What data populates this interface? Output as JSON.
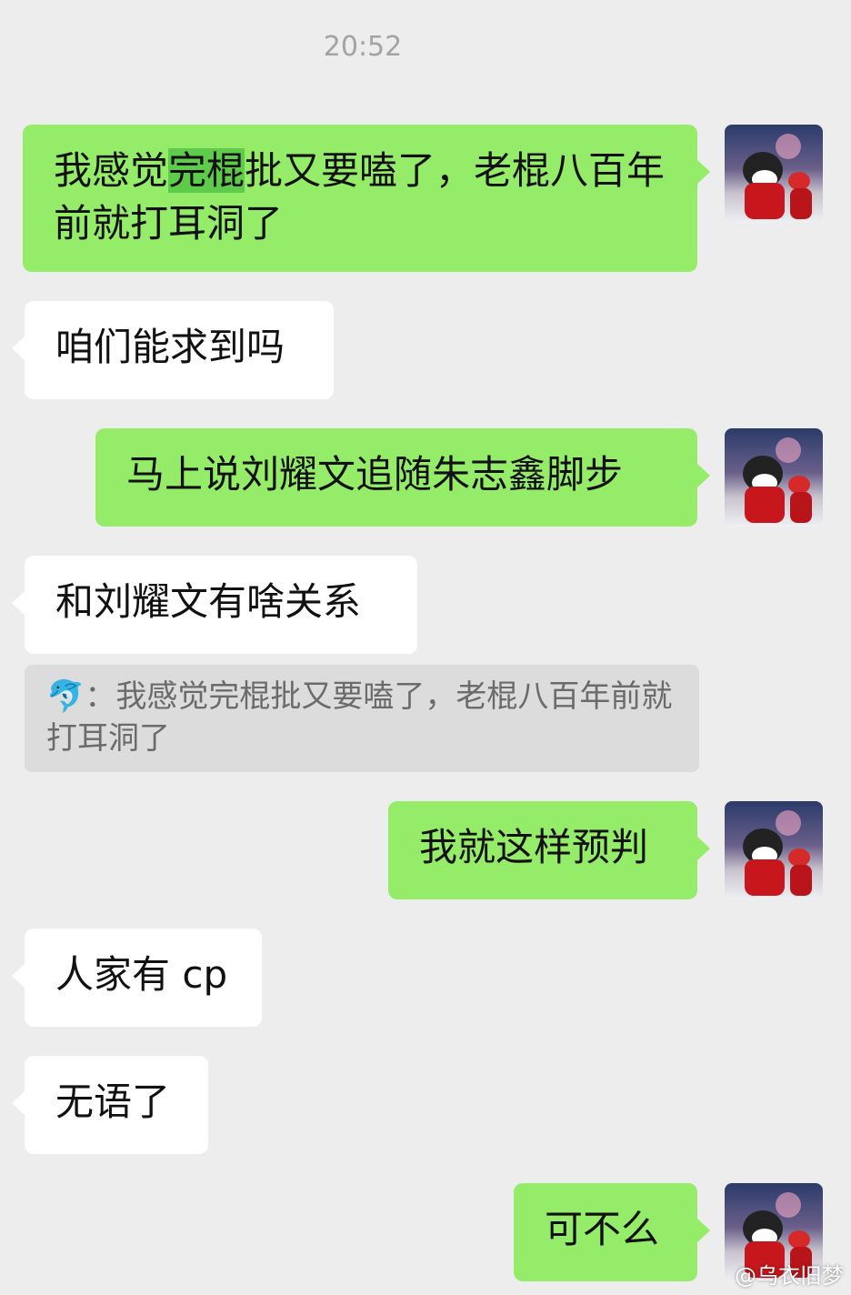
{
  "timestamp": "20:52",
  "messages": [
    {
      "side": "out",
      "before": "我感觉",
      "highlight": "完棍",
      "after": "批又要嗑了，老棍八百年前就打耳洞了"
    },
    {
      "side": "in",
      "text": "咱们能求到吗"
    },
    {
      "side": "out",
      "text": "马上说刘耀文追随朱志鑫脚步"
    },
    {
      "side": "in",
      "text": "和刘耀文有啥关系"
    },
    {
      "side": "out",
      "text": "我就这样预判"
    },
    {
      "side": "in",
      "text": "人家有 cp"
    },
    {
      "side": "in",
      "text": "无语了"
    },
    {
      "side": "out",
      "text": "可不么"
    }
  ],
  "quote": {
    "sender_emoji": "🐬",
    "text": "：我感觉完棍批又要嗑了，老棍八百年前就打耳洞了"
  },
  "watermark": "@乌衣旧梦",
  "colors": {
    "background": "#ededed",
    "outgoing": "#95ec69",
    "incoming": "#ffffff"
  }
}
